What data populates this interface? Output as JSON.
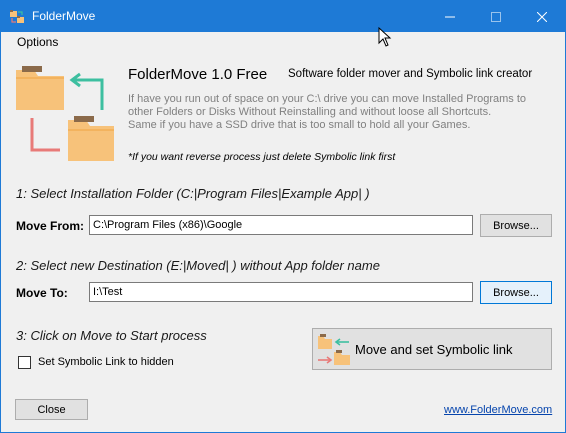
{
  "window": {
    "title": "FolderMove",
    "accent": "#1e7ad6"
  },
  "menu": {
    "options_label": "Options"
  },
  "header": {
    "app_name": "FolderMove 1.0 Free",
    "tagline": "Software folder mover and Symbolic link creator",
    "desc_line1": "If have you run out of space on your C:\\ drive you can move Installed Programs to",
    "desc_line2": "other Folders or Disks Without Reinstalling and without loose all Shortcuts.",
    "desc_line3": "Same if you have a SSD drive that is too small to hold all your Games.",
    "note": "*If you want reverse process just delete Symbolic link first"
  },
  "step1": {
    "label": "1: Select Installation Folder (C:|Program Files|Example App| )",
    "field_label": "Move From:",
    "value": "C:\\Program Files (x86)\\Google",
    "browse_label": "Browse..."
  },
  "step2": {
    "label": "2: Select new Destination (E:|Moved| ) without App folder name",
    "field_label": "Move To:",
    "value": "I:\\Test",
    "browse_label": "Browse..."
  },
  "step3": {
    "label": "3: Click on Move to Start process",
    "checkbox_label": "Set Symbolic Link to hidden",
    "checkbox_checked": false,
    "move_button_label": "Move and set Symbolic link"
  },
  "footer": {
    "close_label": "Close",
    "link_text": "www.FolderMove.com"
  },
  "icons": {
    "folder_color": "#f7c27a",
    "folder_tab_color": "#8b6a4a",
    "arrow_green": "#3dbfa0",
    "arrow_red": "#e87a78"
  }
}
